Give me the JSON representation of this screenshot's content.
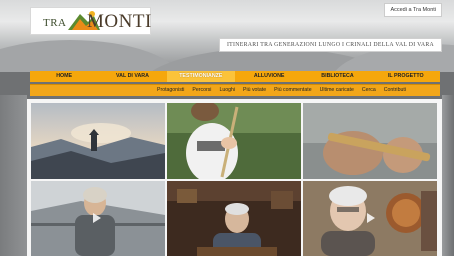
{
  "header": {
    "login_label": "Accedi a Tra Monti",
    "logo": {
      "prefix": "TRA",
      "suffix": "MONTI"
    },
    "tagline": "ITINERARI TRA GENERAZIONI LUNGO I CRINALI DELLA VAL DI VARA"
  },
  "nav": {
    "items": [
      {
        "label": "HOME"
      },
      {
        "label": "VAL DI VARA"
      },
      {
        "label": "TESTIMONIANZE"
      },
      {
        "label": "ALLUVIONE"
      },
      {
        "label": "BIBLIOTECA"
      },
      {
        "label": "IL PROGETTO"
      }
    ],
    "active_index": 2
  },
  "subnav": {
    "items": [
      {
        "label": "Protagonisti"
      },
      {
        "label": "Percorsi"
      },
      {
        "label": "Luoghi"
      },
      {
        "label": "Più votate"
      },
      {
        "label": "Più commentate"
      },
      {
        "label": "Ultime caricate"
      },
      {
        "label": "Cerca"
      },
      {
        "label": "Contributi"
      }
    ]
  },
  "thumbnails": [
    {
      "name": "thumb-hills-sunset",
      "has_play": false
    },
    {
      "name": "thumb-child-stick",
      "has_play": false
    },
    {
      "name": "thumb-hands-flute",
      "has_play": false
    },
    {
      "name": "thumb-woman-terrace",
      "has_play": true
    },
    {
      "name": "thumb-man-portrait",
      "has_play": false
    },
    {
      "name": "thumb-elderly-woman",
      "has_play": true
    }
  ],
  "colors": {
    "nav_orange": "#f5a70c",
    "nav_active": "#fbc33a",
    "page_background": "#6f7173"
  }
}
